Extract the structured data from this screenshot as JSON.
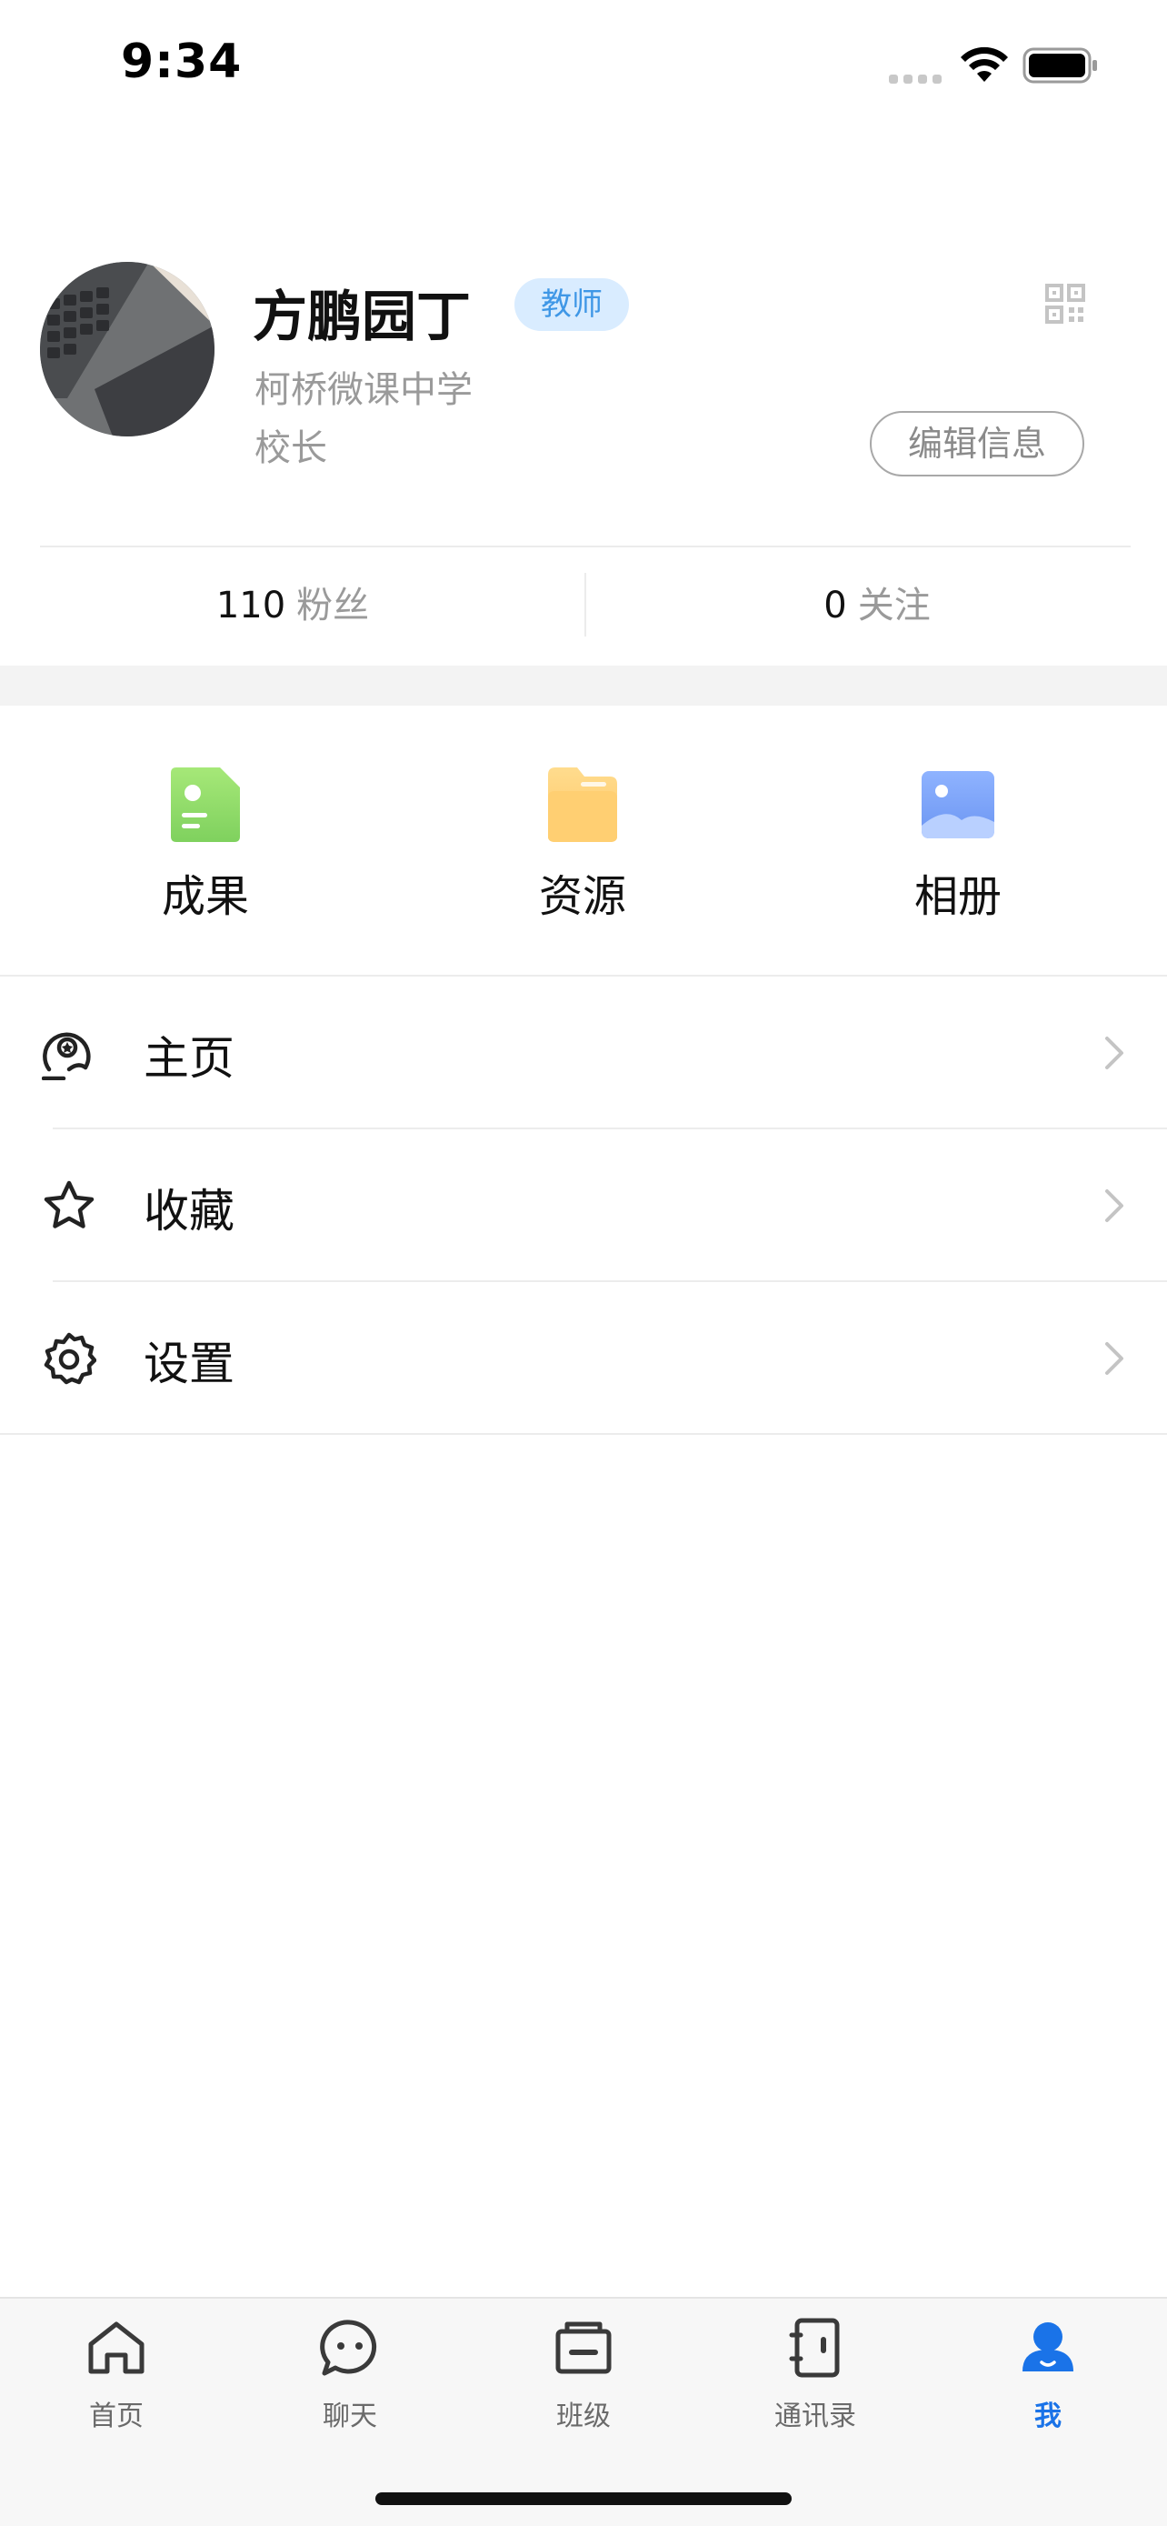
{
  "status_bar": {
    "time": "9:34"
  },
  "profile": {
    "name": "方鹏园丁",
    "role_badge": "教师",
    "school": "柯桥微课中学",
    "position": "校长",
    "edit_button": "编辑信息"
  },
  "stats": {
    "fans_count": "110",
    "fans_label": "粉丝",
    "follow_count": "0",
    "follow_label": "关注"
  },
  "tiles": [
    {
      "label": "成果",
      "icon": "achievement-icon",
      "color": "#8fd96a"
    },
    {
      "label": "资源",
      "icon": "folder-icon",
      "color": "#ffd27a"
    },
    {
      "label": "相册",
      "icon": "album-icon",
      "color": "#6f9bf5"
    }
  ],
  "menu": [
    {
      "label": "主页",
      "icon": "homepage-icon"
    },
    {
      "label": "收藏",
      "icon": "star-icon"
    },
    {
      "label": "设置",
      "icon": "gear-icon"
    }
  ],
  "tabbar": {
    "active_color": "#1a73e8",
    "tabs": [
      {
        "label": "首页",
        "icon": "home-icon"
      },
      {
        "label": "聊天",
        "icon": "chat-icon"
      },
      {
        "label": "班级",
        "icon": "class-icon"
      },
      {
        "label": "通讯录",
        "icon": "contacts-icon"
      },
      {
        "label": "我",
        "icon": "me-icon",
        "active": true
      }
    ]
  }
}
